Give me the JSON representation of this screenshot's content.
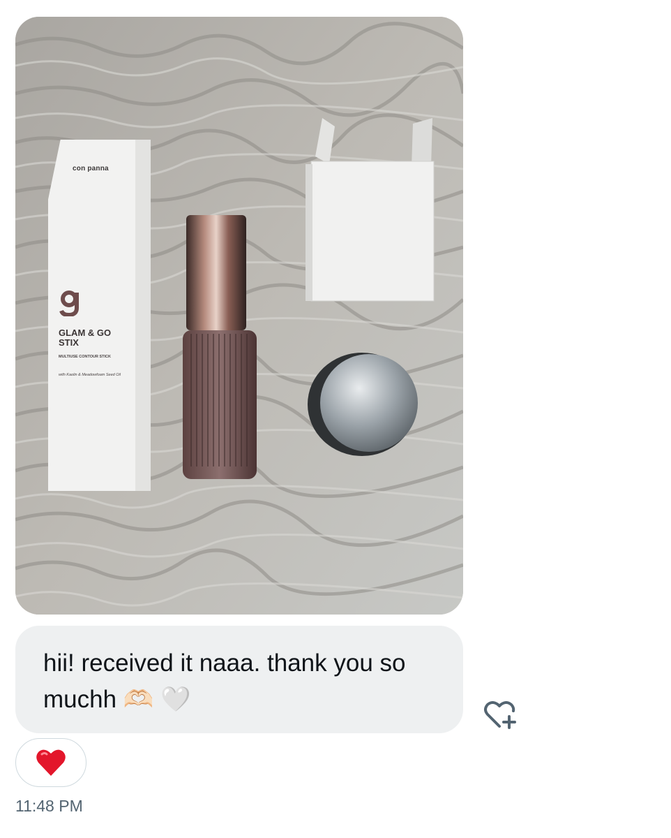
{
  "message": {
    "photo": {
      "alt": "Photo of products on a carpet",
      "box_brand": "con panna",
      "box_product_name": "GLAM & GO STIX",
      "box_product_type": "MULTIUSE CONTOUR STICK",
      "box_ingredients": "with Kaolin & Meadowfoam Seed Oil"
    },
    "text": "hii! received it naaa. thank you so muchh 🫶🏻 🤍",
    "add_reaction_icon": "heart-plus-icon",
    "reaction": {
      "emoji": "❤️",
      "icon": "red-heart-icon"
    },
    "timestamp": "11:48 PM"
  },
  "colors": {
    "bubble_bg": "#eef0f1",
    "text": "#0f1419",
    "timestamp": "#536471",
    "pill_border": "#cfd9de",
    "heart": "#e0245e"
  }
}
